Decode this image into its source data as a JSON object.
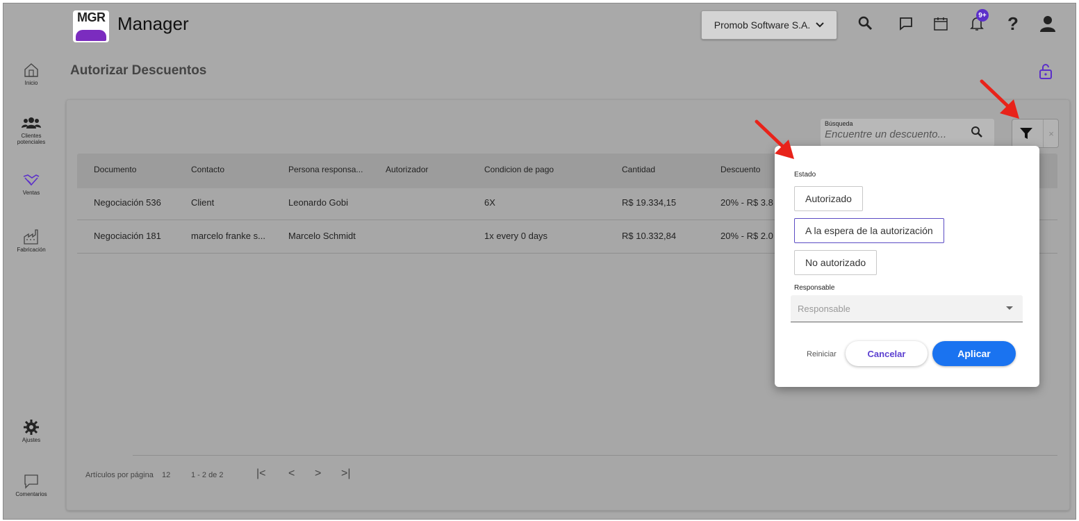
{
  "header": {
    "logo_text": "MGR",
    "app_title": "Manager",
    "company": "Promob Software S.A.",
    "notification_badge": "9+"
  },
  "sidebar": {
    "items": [
      {
        "label": "Inicio",
        "icon": "home-icon"
      },
      {
        "label": "Clientes potenciales",
        "icon": "users-icon"
      },
      {
        "label": "Ventas",
        "icon": "handshake-icon"
      },
      {
        "label": "Fabricación",
        "icon": "factory-icon"
      },
      {
        "label": "Ajustes",
        "icon": "gear-icon"
      },
      {
        "label": "Comentarios",
        "icon": "comment-icon"
      }
    ]
  },
  "page": {
    "title": "Autorizar Descuentos"
  },
  "search": {
    "label": "Búsqueda",
    "placeholder": "Encuentre un descuento..."
  },
  "table": {
    "columns": [
      "Documento",
      "Contacto",
      "Persona responsa...",
      "Autorizador",
      "Condicion de pago",
      "Cantidad",
      "Descuento"
    ],
    "rows": [
      [
        "Negociación 536",
        "Client",
        "Leonardo Gobi",
        "",
        "6X",
        "R$ 19.334,15",
        "20% - R$ 3.8"
      ],
      [
        "Negociación 181",
        "marcelo franke s...",
        "Marcelo Schmidt",
        "",
        "1x every 0 days",
        "R$ 10.332,84",
        "20% - R$ 2.0"
      ]
    ]
  },
  "pagination": {
    "items_per_page_label": "Artículos por página",
    "items_per_page": "12",
    "range": "1 - 2 de 2"
  },
  "filter_popup": {
    "estado_label": "Estado",
    "options": [
      "Autorizado",
      "A la espera de la autorización",
      "No autorizado"
    ],
    "selected": "A la espera de la autorización",
    "responsable_label": "Responsable",
    "responsable_placeholder": "Responsable",
    "reset_label": "Reiniciar",
    "cancel_label": "Cancelar",
    "apply_label": "Aplicar"
  },
  "colors": {
    "accent": "#5b2fc9",
    "apply_button": "#1a73f0",
    "annotation_arrow": "#e8231a"
  }
}
